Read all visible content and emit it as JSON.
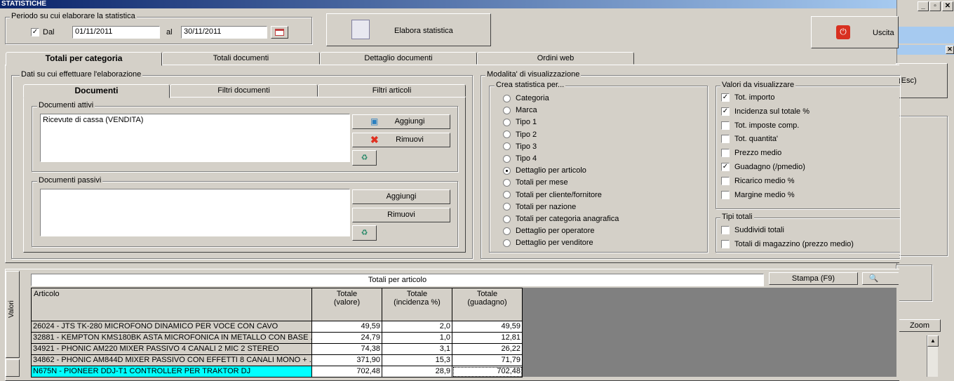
{
  "window": {
    "title": "STATISTICHE"
  },
  "periodo": {
    "legend": "Periodo su cui elaborare la statistica",
    "dal_label": "Dal",
    "dal_value": "01/11/2011",
    "al_label": "al",
    "al_value": "30/11/2011"
  },
  "actions": {
    "elabora": "Elabora statistica",
    "uscita": "Uscita",
    "esc": "(Esc)"
  },
  "tabs": [
    "Totali per categoria",
    "Totali documenti",
    "Dettaglio documenti",
    "Ordini web"
  ],
  "dati": {
    "legend": "Dati su cui effettuare l'elaborazione",
    "subtabs": [
      "Documenti",
      "Filtri documenti",
      "Filtri articoli"
    ],
    "attivi": {
      "legend": "Documenti attivi",
      "items": [
        "Ricevute di cassa (VENDITA)"
      ],
      "add": "Aggiungi",
      "remove": "Rimuovi"
    },
    "passivi": {
      "legend": "Documenti passivi",
      "add": "Aggiungi",
      "remove": "Rimuovi"
    }
  },
  "modalita": {
    "legend": "Modalita' di visualizzazione",
    "crea_legend": "Crea statistica per...",
    "options": [
      "Categoria",
      "Marca",
      "Tipo 1",
      "Tipo 2",
      "Tipo 3",
      "Tipo 4",
      "Dettaglio per articolo",
      "Totali per mese",
      "Totali per cliente/fornitore",
      "Totali per nazione",
      "Totali per categoria anagrafica",
      "Dettaglio per operatore",
      "Dettaglio per venditore"
    ],
    "selected": 6,
    "valori_legend": "Valori da visualizzare",
    "valori": [
      {
        "label": "Tot. importo",
        "checked": true
      },
      {
        "label": "Incidenza sul totale %",
        "checked": true
      },
      {
        "label": "Tot. imposte comp.",
        "checked": false
      },
      {
        "label": "Tot. quantita'",
        "checked": false
      },
      {
        "label": "Prezzo medio",
        "checked": false
      },
      {
        "label": "Guadagno (/pmedio)",
        "checked": true
      },
      {
        "label": "Ricarico medio %",
        "checked": false
      },
      {
        "label": "Margine medio %",
        "checked": false
      }
    ],
    "tipi_legend": "Tipi totali",
    "tipi": [
      {
        "label": "Suddividi totali",
        "checked": false
      },
      {
        "label": "Totali di magazzino (prezzo medio)",
        "checked": false
      }
    ]
  },
  "results": {
    "side_tab": "Valori",
    "title": "Totali per articolo",
    "stampa": "Stampa (F9)",
    "zoom": "Zoom",
    "headers": [
      "Articolo",
      "Totale\n(valore)",
      "Totale\n(incidenza %)",
      "Totale\n(guadagno)"
    ],
    "rows": [
      [
        "26024 - JTS TK-280 MICROFONO DINAMICO PER VOCE CON CAVO",
        "49,59",
        "2,0",
        "49,59"
      ],
      [
        "32881 - KEMPTON KMS180BK ASTA MICROFONICA IN METALLO CON BASE ...",
        "24,79",
        "1,0",
        "12,81"
      ],
      [
        "34921 - PHONIC AM220 MIXER PASSIVO 4 CANALI 2 MIC 2 STEREO",
        "74,38",
        "3,1",
        "26,22"
      ],
      [
        "34862 - PHONIC AM844D MIXER PASSIVO CON EFFETTI 8 CANALI MONO + ...",
        "371,90",
        "15,3",
        "71,79"
      ],
      [
        "N675N - PIONEER DDJ-T1 CONTROLLER PER TRAKTOR DJ",
        "702,48",
        "28,9",
        "702,48"
      ]
    ]
  },
  "colors": {
    "highlight": "#00ffff",
    "titlebar": "#0a246a",
    "face": "#d4d0c8"
  }
}
